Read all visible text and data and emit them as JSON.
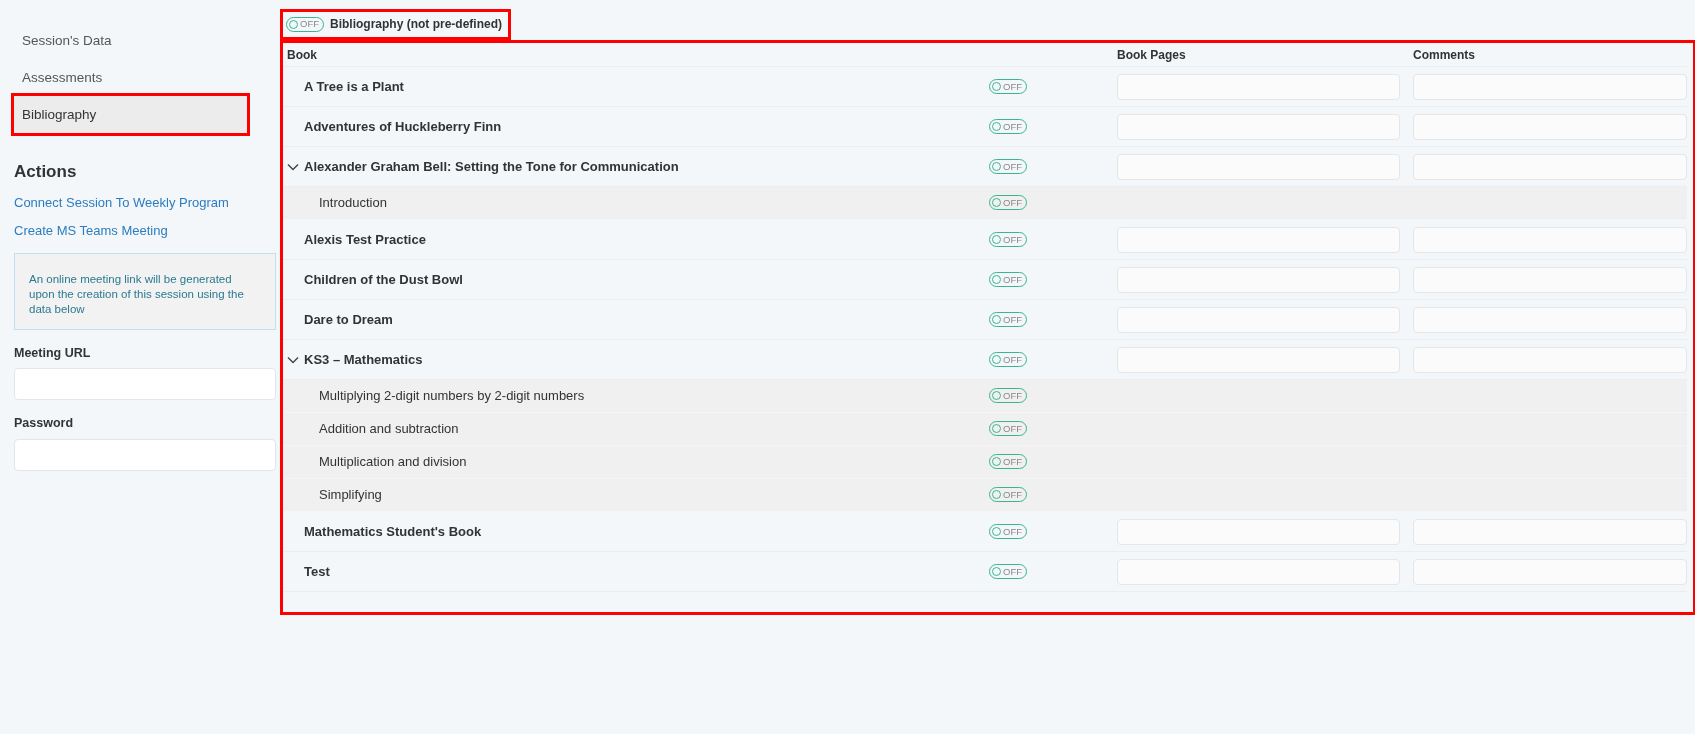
{
  "sidebar": {
    "items": [
      {
        "label": "Session's Data",
        "selected": false,
        "highlighted": false
      },
      {
        "label": "Assessments",
        "selected": false,
        "highlighted": false
      },
      {
        "label": "Bibliography",
        "selected": true,
        "highlighted": true
      }
    ],
    "actions": {
      "title": "Actions",
      "links": [
        "Connect Session To Weekly Program",
        "Create MS Teams Meeting"
      ],
      "info": "An online meeting link will be generated upon the creation of this session using the data below",
      "fields": [
        {
          "label": "Meeting URL"
        },
        {
          "label": "Password"
        }
      ]
    }
  },
  "bibliography_toggle": {
    "label": "Bibliography (not pre-defined)",
    "switch_text": "OFF",
    "on": false,
    "highlighted": true
  },
  "table": {
    "highlighted": true,
    "columns": [
      "Book",
      "Book Pages",
      "Comments"
    ],
    "rows": [
      {
        "title": "A Tree is a Plant",
        "switch_text": "OFF",
        "on": false
      },
      {
        "title": "Adventures of Huckleberry Finn",
        "switch_text": "OFF",
        "on": false
      },
      {
        "title": "Alexander Graham Bell: Setting the Tone for Communication",
        "switch_text": "OFF",
        "on": false,
        "expanded": true,
        "children": [
          {
            "title": "Introduction",
            "switch_text": "OFF",
            "on": false
          }
        ]
      },
      {
        "title": "Alexis Test Practice",
        "switch_text": "OFF",
        "on": false
      },
      {
        "title": "Children of the Dust Bowl",
        "switch_text": "OFF",
        "on": false
      },
      {
        "title": "Dare to Dream",
        "switch_text": "OFF",
        "on": false
      },
      {
        "title": "KS3 – Mathematics",
        "switch_text": "OFF",
        "on": false,
        "expanded": true,
        "children": [
          {
            "title": "Multiplying 2-digit numbers by 2-digit numbers",
            "switch_text": "OFF",
            "on": false
          },
          {
            "title": "Addition and subtraction",
            "switch_text": "OFF",
            "on": false
          },
          {
            "title": "Multiplication and division",
            "switch_text": "OFF",
            "on": false
          },
          {
            "title": "Simplifying",
            "switch_text": "OFF",
            "on": false
          }
        ]
      },
      {
        "title": "Mathematics Student's Book",
        "switch_text": "OFF",
        "on": false
      },
      {
        "title": "Test",
        "switch_text": "OFF",
        "on": false
      }
    ]
  }
}
